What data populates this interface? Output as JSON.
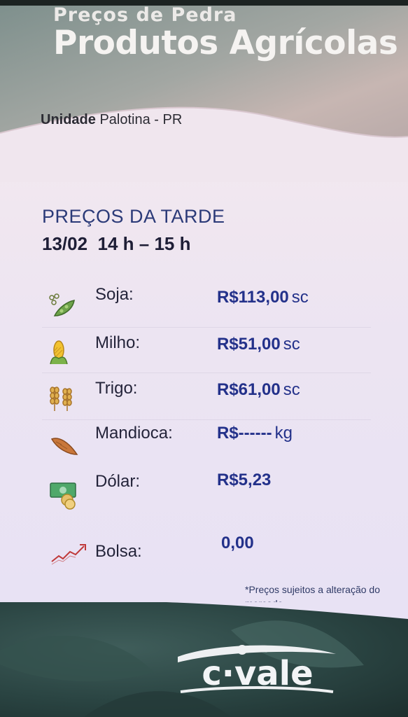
{
  "header": {
    "subtitle": "Preços de Pedra",
    "title": "Produtos Agrícolas"
  },
  "unit": {
    "label": "Unidade",
    "name": "Palotina - PR"
  },
  "period": {
    "title": "PREÇOS DA  TARDE",
    "date_time": "13/02  14 h – 15 h"
  },
  "prices": [
    {
      "name": "Soja:",
      "value": "R$113,00",
      "unit": "sc",
      "icon": "soybean-icon"
    },
    {
      "name": "Milho:",
      "value": "R$51,00",
      "unit": "sc",
      "icon": "corn-icon"
    },
    {
      "name": "Trigo:",
      "value": "R$61,00",
      "unit": "sc",
      "icon": "wheat-icon"
    },
    {
      "name": "Mandioca:",
      "value": "R$------",
      "unit": "kg",
      "icon": "cassava-icon"
    },
    {
      "name": "Dólar:",
      "value": "R$5,23",
      "unit": "",
      "icon": "money-icon"
    },
    {
      "name": "Bolsa:",
      "value": "0,00",
      "unit": "",
      "icon": "stock-chart-icon"
    }
  ],
  "note": "*Preços sujeitos a alteração do mercado.",
  "logo": {
    "text": "c·vale"
  },
  "colors": {
    "price": "#23318a",
    "header_text": "#f5f3f1",
    "panel": "#ece4f2"
  }
}
